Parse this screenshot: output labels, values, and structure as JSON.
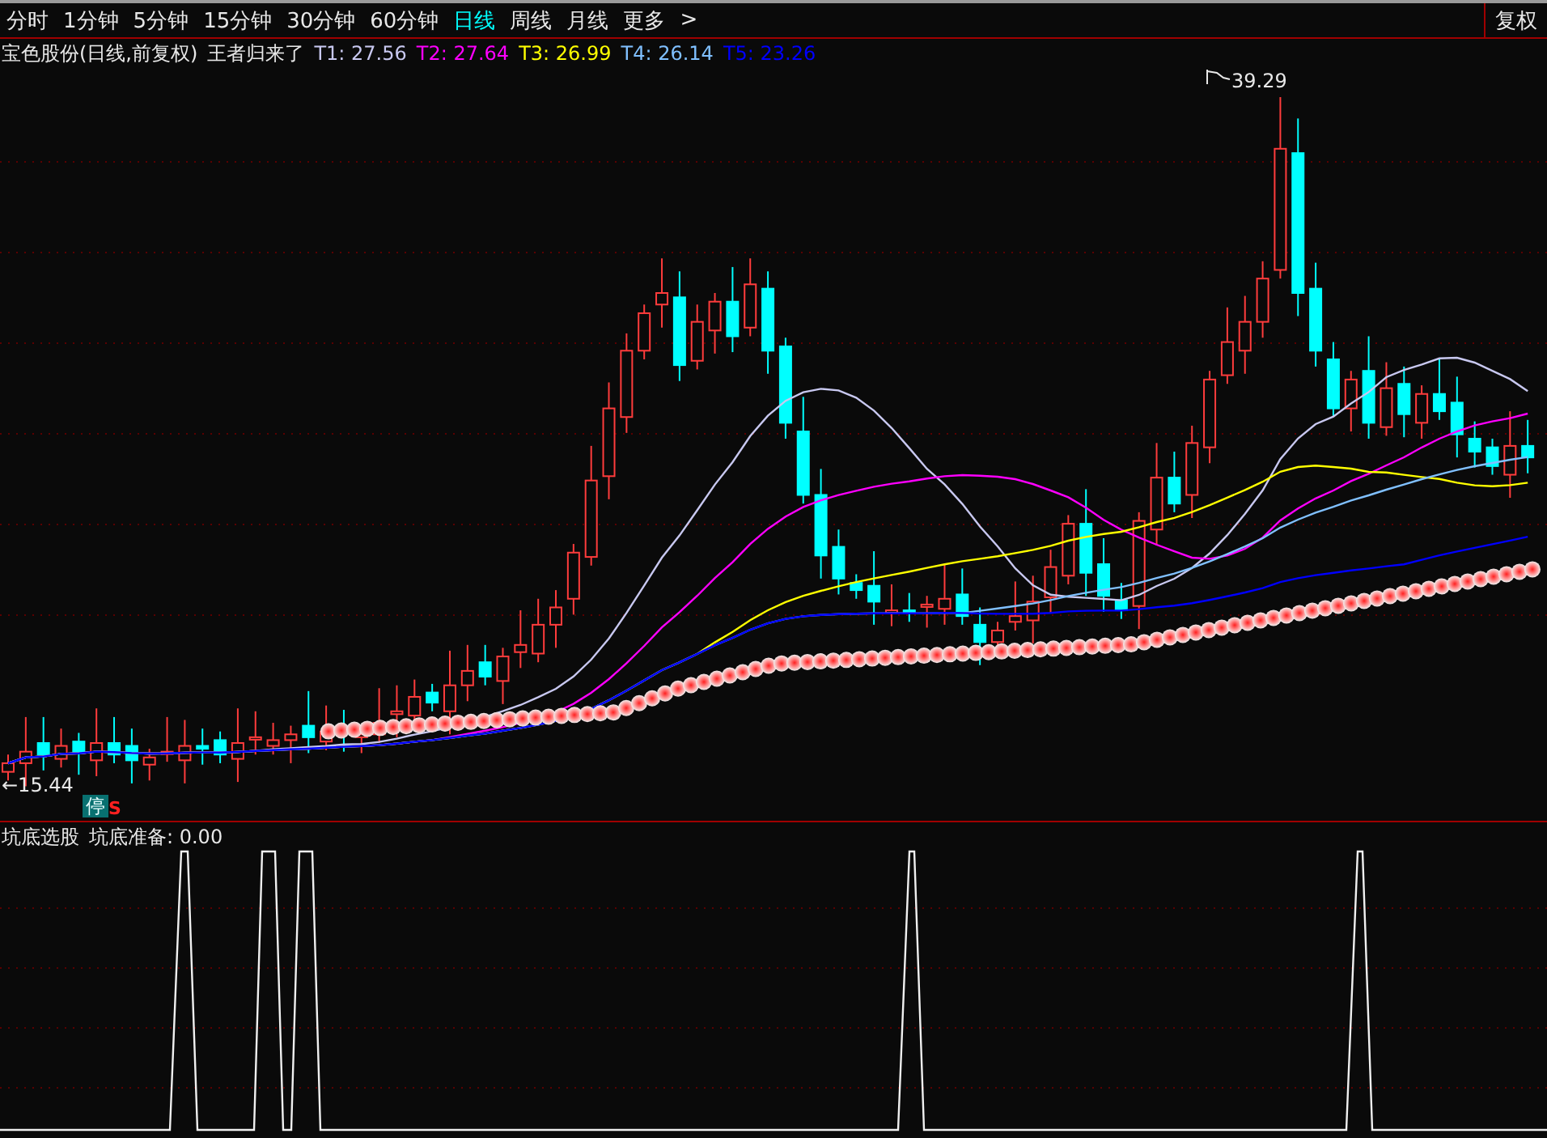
{
  "toolbar": {
    "periods": [
      {
        "label": "分时",
        "selected": false
      },
      {
        "label": "1分钟",
        "selected": false
      },
      {
        "label": "5分钟",
        "selected": false
      },
      {
        "label": "15分钟",
        "selected": false
      },
      {
        "label": "30分钟",
        "selected": false
      },
      {
        "label": "60分钟",
        "selected": false
      },
      {
        "label": "日线",
        "selected": true
      },
      {
        "label": "周线",
        "selected": false
      },
      {
        "label": "月线",
        "selected": false
      },
      {
        "label": "更多",
        "selected": false
      }
    ],
    "more_arrow": ">",
    "adjust_button": "复权"
  },
  "main_chart": {
    "title": "宝色股份(日线,前复权)",
    "indicator": "王者归来了",
    "legend": [
      {
        "text": "T1: 27.56",
        "color": "#c8c8f0"
      },
      {
        "text": "T2: 27.64",
        "color": "#ff00ff"
      },
      {
        "text": "T3: 26.99",
        "color": "#ffff00"
      },
      {
        "text": "T4: 26.14",
        "color": "#80c0ff"
      },
      {
        "text": "T5: 23.26",
        "color": "#0000ff"
      }
    ],
    "high_label": "39.29",
    "low_label": "←15.44",
    "halt_badge": "停",
    "signal_mark": "S"
  },
  "sub_chart": {
    "title": "坑底选股",
    "reading": "坑底准备: 0.00"
  }
}
